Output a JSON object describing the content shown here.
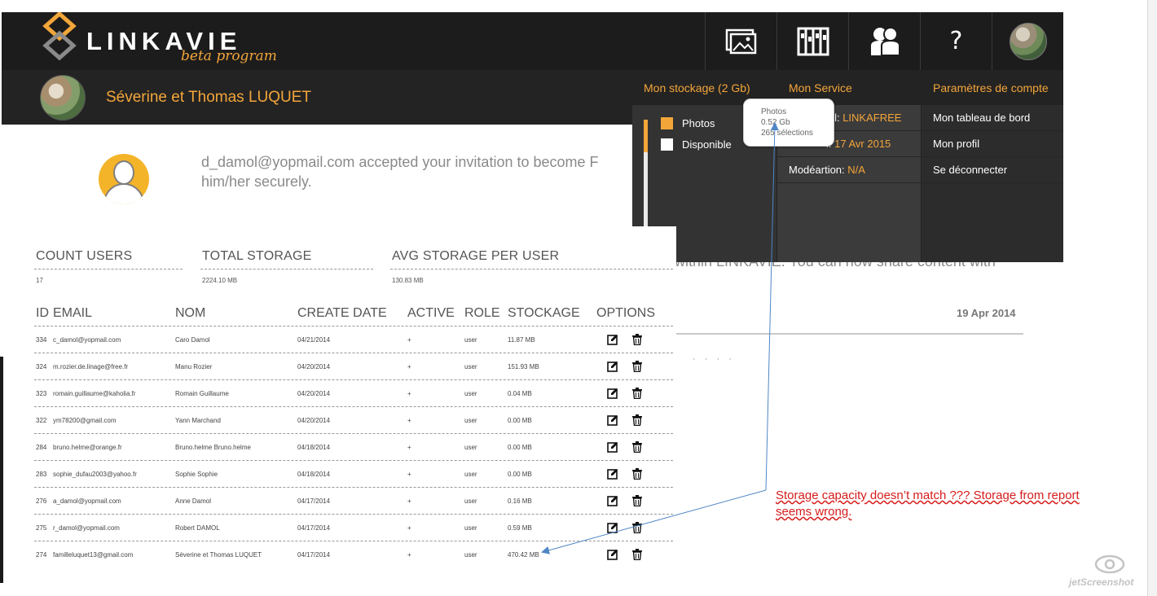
{
  "app": {
    "logo_text": "LINKAVIE",
    "logo_sub": "beta program",
    "nav_icons": [
      "photos-icon",
      "selections-icon",
      "users-icon",
      "help-icon",
      "profile-avatar"
    ],
    "help_label": "?",
    "user_name": "Séverine et Thomas LUQUET"
  },
  "notification": {
    "line1": "d_damol@yopmail.com accepted your invitation to become F",
    "line2": "him/her securely.",
    "tail": "within LINKAVIE. You can now share content with",
    "date": "19 Apr 2014"
  },
  "dropdown": {
    "storage_title": "Mon stockage (2 Gb)",
    "legend_photos": "Photos",
    "legend_available": "Disponible",
    "service_title": "Mon Service",
    "service_row1_prefix": "tuel: ",
    "service_row1_value": "LINKAFREE",
    "service_row2_prefix": "i: ",
    "service_row2_value": "17 Avr 2015",
    "service_row3_prefix": "Modéartion: ",
    "service_row3_value": "N/A",
    "account_title": "Paramètres de compte",
    "account_items": [
      "Mon tableau de bord",
      "Mon profil",
      "Se déconnecter"
    ],
    "colors": {
      "accent": "#f2a63a",
      "photos": "#f2a63a",
      "available": "#ffffff"
    },
    "photos_used_fraction": 0.26
  },
  "tooltip": {
    "line1": "Photos",
    "line2": "0.52 Gb",
    "line3": "265 sélections"
  },
  "report": {
    "stats_headers": [
      "COUNT USERS",
      "TOTAL STORAGE",
      "AVG STORAGE PER USER"
    ],
    "stats_values": [
      "17",
      "2224.10 MB",
      "130.83 MB"
    ],
    "table_headers": [
      "ID",
      "EMAIL",
      "NOM",
      "CREATE DATE",
      "ACTIVE",
      "ROLE",
      "STOCKAGE",
      "OPTIONS"
    ],
    "rows": [
      {
        "id": "334",
        "email": "c_damol@yopmail.com",
        "nom": "Caro Damol",
        "date": "04/21/2014",
        "active": "+",
        "role": "user",
        "storage": "11.87 MB"
      },
      {
        "id": "324",
        "email": "m.rozier.de.linage@free.fr",
        "nom": "Manu Rozier",
        "date": "04/20/2014",
        "active": "+",
        "role": "user",
        "storage": "151.93 MB"
      },
      {
        "id": "323",
        "email": "romain.guillaume@kaholia.fr",
        "nom": "Romain Guillaume",
        "date": "04/20/2014",
        "active": "+",
        "role": "user",
        "storage": "0.04 MB"
      },
      {
        "id": "322",
        "email": "ym78200@gmail.com",
        "nom": "Yann Marchand",
        "date": "04/20/2014",
        "active": "+",
        "role": "user",
        "storage": "0.00 MB"
      },
      {
        "id": "284",
        "email": "bruno.helme@orange.fr",
        "nom": "Bruno.helme Bruno.helme",
        "date": "04/18/2014",
        "active": "+",
        "role": "user",
        "storage": "0.00 MB"
      },
      {
        "id": "283",
        "email": "sophie_dufau2003@yahoo.fr",
        "nom": "Sophie Sophie",
        "date": "04/18/2014",
        "active": "+",
        "role": "user",
        "storage": "0.00 MB"
      },
      {
        "id": "276",
        "email": "a_damol@yopmail.com",
        "nom": "Anne Damol",
        "date": "04/17/2014",
        "active": "+",
        "role": "user",
        "storage": "0.16 MB"
      },
      {
        "id": "275",
        "email": "r_damol@yopmail.com",
        "nom": "Robert DAMOL",
        "date": "04/17/2014",
        "active": "+",
        "role": "user",
        "storage": "0.59 MB"
      },
      {
        "id": "274",
        "email": "familleluquet13@gmail.com",
        "nom": "Séverine et Thomas LUQUET",
        "date": "04/17/2014",
        "active": "+",
        "role": "user",
        "storage": "470.42 MB"
      }
    ]
  },
  "annotation": {
    "text": "Storage capacity doesn’t match ??? Storage from report seems wrong."
  },
  "watermark": {
    "text": "jetScreenshot"
  }
}
